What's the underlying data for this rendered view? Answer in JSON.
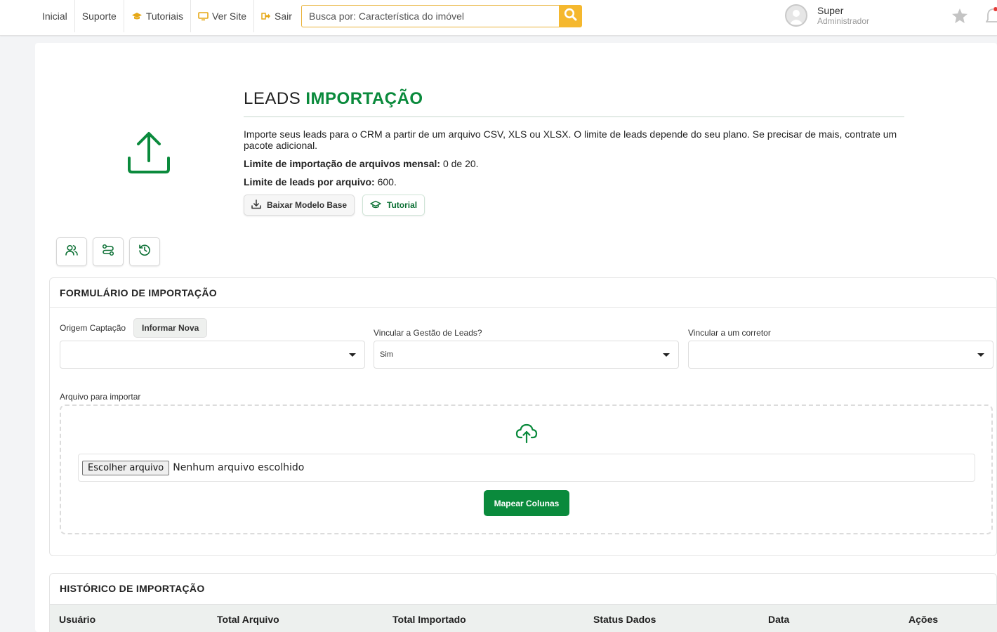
{
  "topbar": {
    "nav": [
      {
        "label": "Inicial",
        "icon": ""
      },
      {
        "label": "Suporte",
        "icon": ""
      },
      {
        "label": "Tutoriais",
        "icon": "graduation-cap-icon"
      },
      {
        "label": "Ver Site",
        "icon": "monitor-icon"
      },
      {
        "label": "Sair",
        "icon": "sign-out-icon"
      }
    ],
    "search_placeholder": "Busca por: Característica do imóvel",
    "user_name": "Super",
    "user_role": "Administrador"
  },
  "header": {
    "title_plain": "LEADS ",
    "title_accent": "IMPORTAÇÃO",
    "description": "Importe seus leads para o CRM a partir de um arquivo CSV, XLS ou XLSX. O limite de leads depende do seu plano. Se precisar de mais, contrate um pacote adicional.",
    "limit_files_label": "Limite de importação de arquivos mensal:",
    "limit_files_value": " 0 de 20.",
    "limit_leads_label": "Limite de leads por arquivo:",
    "limit_leads_value": " 600.",
    "download_label": "Baixar Modelo Base",
    "tutorial_label": "Tutorial"
  },
  "form": {
    "heading": "FORMULÁRIO DE IMPORTAÇÃO",
    "origem_label": "Origem Captação",
    "origem_new_label": "Informar Nova",
    "origem_value": "",
    "vincular_label": "Vincular a Gestão de Leads?",
    "vincular_value": "Sim",
    "corretor_label": "Vincular a um corretor",
    "corretor_value": "",
    "file_label": "Arquivo para importar",
    "file_button": "Escolher arquivo",
    "file_status": "Nenhum arquivo escolhido",
    "submit_label": "Mapear Colunas"
  },
  "history": {
    "heading": "HISTÓRICO DE IMPORTAÇÃO",
    "columns": [
      "Usuário",
      "Total Arquivo",
      "Total Importado",
      "Status Dados",
      "Data",
      "Ações"
    ]
  },
  "colors": {
    "accent_green": "#0a8a3c",
    "search_yellow": "#f5b82e",
    "nav_icon_yellow": "#e6a817"
  }
}
